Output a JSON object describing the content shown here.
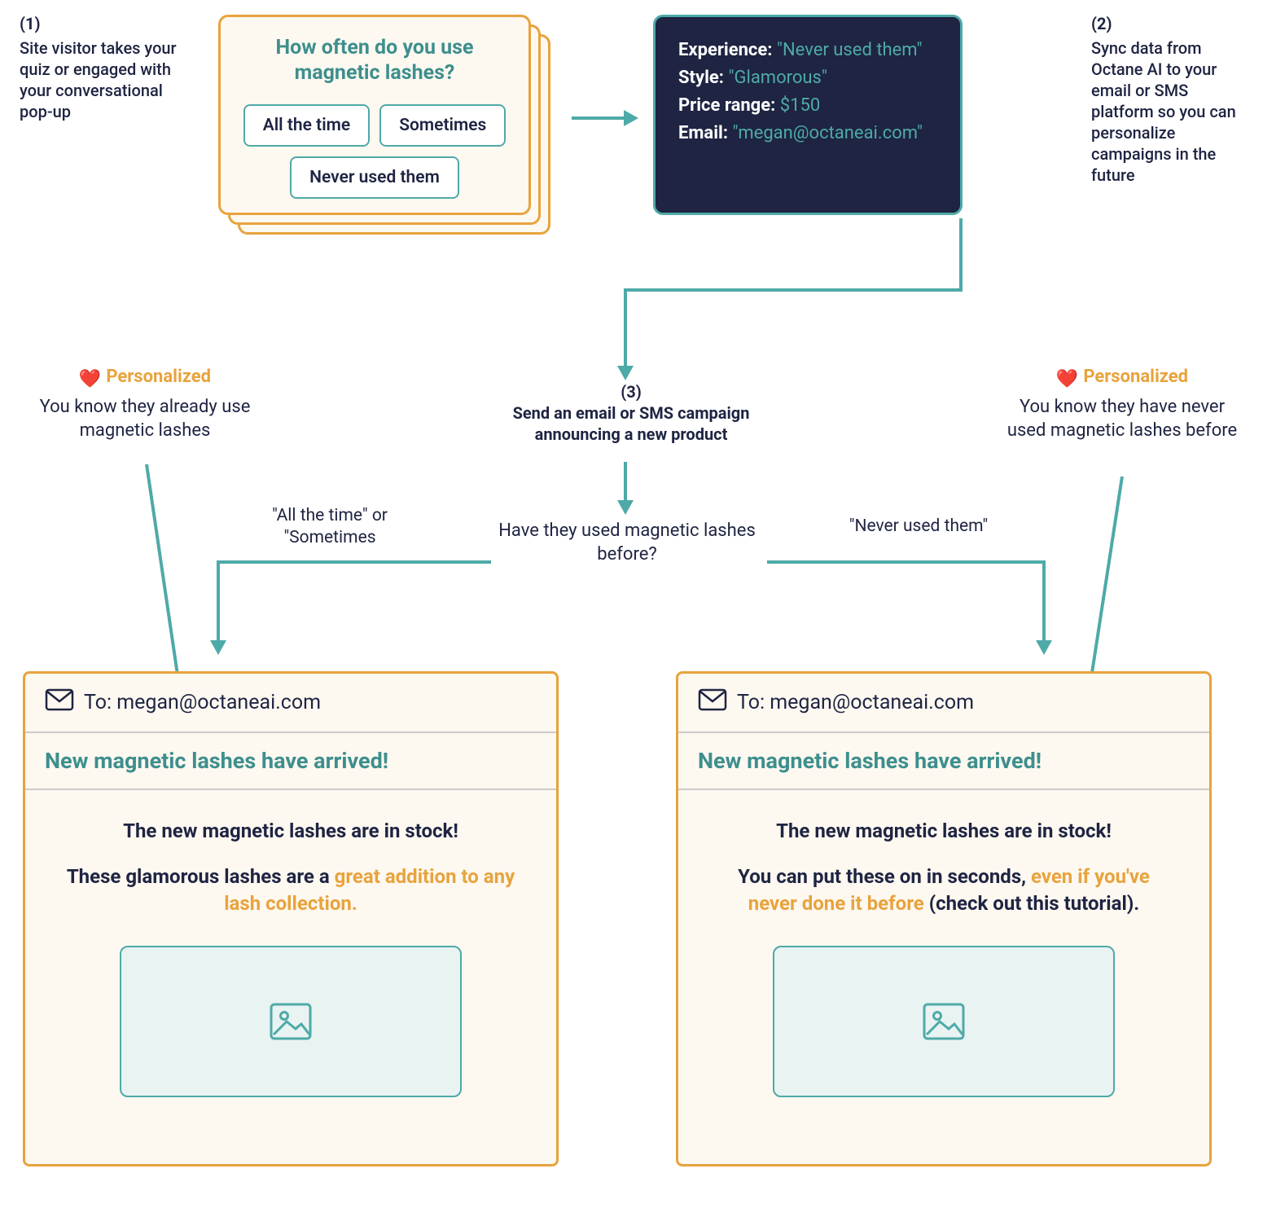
{
  "step1": {
    "num": "(1)",
    "text": "Site visitor takes your quiz or engaged with your conversational pop-up"
  },
  "step2": {
    "num": "(2)",
    "text": "Sync data from Octane AI to your email or SMS platform so you can personalize campaigns in the future"
  },
  "step3": {
    "num": "(3)",
    "text": "Send an email or SMS campaign announcing a new product"
  },
  "quiz": {
    "title": "How often do you use magnetic lashes?",
    "opt1": "All the time",
    "opt2": "Sometimes",
    "opt3": "Never used them"
  },
  "data": {
    "k1": "Experience:",
    "v1": "\"Never used them\"",
    "k2": "Style:",
    "v2": "\"Glamorous\"",
    "k3": "Price range:",
    "v3": "$150",
    "k4": "Email:",
    "v4": "\"megan@octaneai.com\""
  },
  "decision": "Have they used magnetic lashes before?",
  "branchL": "\"All the time\" or \"Sometimes",
  "branchR": "\"Never used them\"",
  "badgeL": {
    "hdr": "Personalized",
    "txt": "You know they already use magnetic lashes"
  },
  "badgeR": {
    "hdr": "Personalized",
    "txt": "You know they have never used magnetic lashes before"
  },
  "emailL": {
    "to": "To: megan@octaneai.com",
    "subj": "New magnetic lashes have arrived!",
    "p1": "The new magnetic lashes are in stock!",
    "p2_pre": "These glamorous lashes are a ",
    "p2_hl": "great addition to any lash collection."
  },
  "emailR": {
    "to": "To: megan@octaneai.com",
    "subj": "New magnetic lashes have arrived!",
    "p1": "The new magnetic lashes are in stock!",
    "p2_pre": "You can put these on in seconds, ",
    "p2_hl": "even if you've never done it before",
    "p2_post": " (check out this tutorial)."
  }
}
